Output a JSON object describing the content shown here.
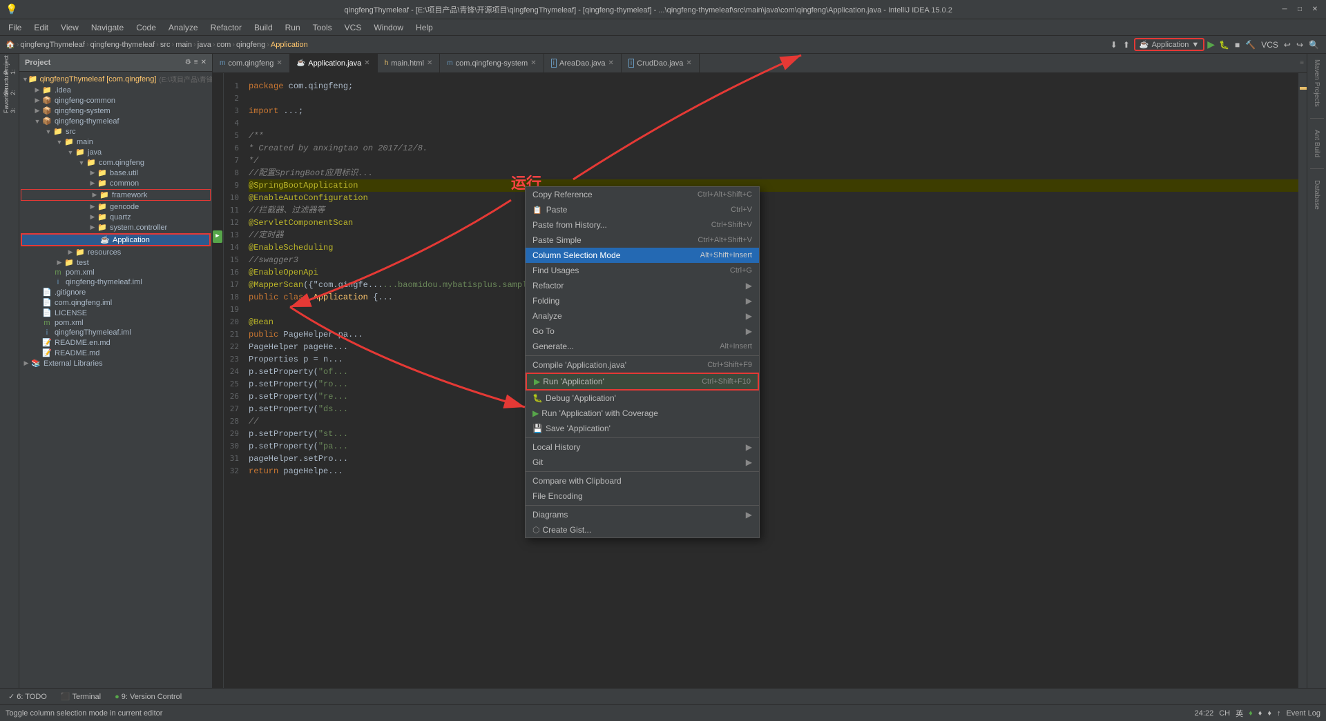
{
  "titleBar": {
    "title": "qingfengThymeleaf - [E:\\项目产品\\青锋\\开源项目\\qingfengThymeleaf] - [qingfeng-thymeleaf] - ...\\qingfeng-thymeleaf\\src\\main\\java\\com\\qingfeng\\Application.java - IntelliJ IDEA 15.0.2",
    "minimize": "─",
    "maximize": "□",
    "close": "✕"
  },
  "menuBar": {
    "items": [
      "File",
      "Edit",
      "View",
      "Navigate",
      "Code",
      "Analyze",
      "Refactor",
      "Build",
      "Run",
      "Tools",
      "VCS",
      "Window",
      "Help"
    ]
  },
  "breadcrumb": {
    "parts": [
      "qingfengThymeleaf",
      "qingfeng-thymeleaf",
      "src",
      "main",
      "java",
      "com",
      "qingfeng",
      "Application"
    ],
    "runConfig": "Application"
  },
  "projectPanel": {
    "title": "Project",
    "tree": [
      {
        "level": 0,
        "type": "project",
        "label": "qingfengThymeleaf [com.qingfeng]",
        "sub": "E:\\项目产品\\青锋\\开源项目\\q",
        "expanded": true
      },
      {
        "level": 1,
        "type": "folder",
        "label": ".idea",
        "expanded": false
      },
      {
        "level": 1,
        "type": "module",
        "label": "qingfeng-common",
        "expanded": false
      },
      {
        "level": 1,
        "type": "module",
        "label": "qingfeng-system",
        "expanded": false
      },
      {
        "level": 1,
        "type": "module",
        "label": "qingfeng-thymeleaf",
        "expanded": true
      },
      {
        "level": 2,
        "type": "folder",
        "label": "src",
        "expanded": true
      },
      {
        "level": 3,
        "type": "folder",
        "label": "main",
        "expanded": true
      },
      {
        "level": 4,
        "type": "folder",
        "label": "java",
        "expanded": true
      },
      {
        "level": 5,
        "type": "folder",
        "label": "com.qingfeng",
        "expanded": true
      },
      {
        "level": 6,
        "type": "folder",
        "label": "base.util",
        "expanded": false
      },
      {
        "level": 6,
        "type": "folder",
        "label": "common",
        "expanded": false
      },
      {
        "level": 6,
        "type": "folder",
        "label": "framework",
        "expanded": false,
        "highlight": true
      },
      {
        "level": 6,
        "type": "folder",
        "label": "gencode",
        "expanded": false
      },
      {
        "level": 6,
        "type": "folder",
        "label": "quartz",
        "expanded": false
      },
      {
        "level": 6,
        "type": "folder",
        "label": "system.controller",
        "expanded": false
      },
      {
        "level": 6,
        "type": "java",
        "label": "Application",
        "selected": true,
        "highlighted": true
      },
      {
        "level": 4,
        "type": "folder",
        "label": "resources",
        "expanded": false
      },
      {
        "level": 3,
        "type": "folder",
        "label": "test",
        "expanded": false
      },
      {
        "level": 2,
        "type": "xml",
        "label": "pom.xml"
      },
      {
        "level": 2,
        "type": "iml",
        "label": "qingfeng-thymeleaf.iml"
      },
      {
        "level": 1,
        "type": "file",
        "label": ".gitignore"
      },
      {
        "level": 1,
        "type": "file",
        "label": "com.qingfeng.iml"
      },
      {
        "level": 1,
        "type": "file",
        "label": "LICENSE"
      },
      {
        "level": 1,
        "type": "xml",
        "label": "pom.xml"
      },
      {
        "level": 1,
        "type": "iml",
        "label": "qingfengThymeleaf.iml"
      },
      {
        "level": 1,
        "type": "md",
        "label": "README.en.md"
      },
      {
        "level": 1,
        "type": "md",
        "label": "README.md"
      },
      {
        "level": 0,
        "type": "folder",
        "label": "External Libraries",
        "expanded": false
      }
    ]
  },
  "tabs": [
    {
      "label": "com.qingfeng",
      "active": false,
      "icon": "m"
    },
    {
      "label": "Application.java",
      "active": true,
      "icon": "j"
    },
    {
      "label": "main.html",
      "active": false,
      "icon": "h"
    },
    {
      "label": "com.qingfeng-system",
      "active": false,
      "icon": "m"
    },
    {
      "label": "AreaDao.java",
      "active": false,
      "icon": "i"
    },
    {
      "label": "CrudDao.java",
      "active": false,
      "icon": "i"
    }
  ],
  "code": {
    "lines": [
      {
        "n": 1,
        "text": "package com.qingfeng;",
        "parts": [
          {
            "t": "kw",
            "v": "package"
          },
          {
            "t": "plain",
            "v": " com.qingfeng;"
          }
        ]
      },
      {
        "n": 2,
        "text": ""
      },
      {
        "n": 3,
        "text": "import ...;",
        "parts": [
          {
            "t": "kw",
            "v": "import"
          },
          {
            "t": "plain",
            "v": " ...;"
          }
        ]
      },
      {
        "n": 4,
        "text": ""
      },
      {
        "n": 5,
        "text": "/**",
        "parts": [
          {
            "t": "comment",
            "v": "/**"
          }
        ]
      },
      {
        "n": 6,
        "text": " * Created by anxingtao on 2017/12/8.",
        "parts": [
          {
            "t": "comment",
            "v": " * Created by anxingtao on 2017/12/8."
          }
        ]
      },
      {
        "n": 7,
        "text": " */",
        "parts": [
          {
            "t": "comment",
            "v": " */"
          }
        ]
      },
      {
        "n": 8,
        "text": "//配置SpringBoot应用标识...",
        "parts": [
          {
            "t": "comment",
            "v": "//配置SpringBoot应用标识..."
          }
        ]
      },
      {
        "n": 9,
        "text": "@SpringBootApplication",
        "parts": [
          {
            "t": "anno",
            "v": "@SpringBootApplication"
          }
        ]
      },
      {
        "n": 10,
        "text": "@EnableAutoConfiguration",
        "parts": [
          {
            "t": "anno",
            "v": "@EnableAutoConfiguration"
          }
        ]
      },
      {
        "n": 11,
        "text": "//拦截器、过滤器等",
        "parts": [
          {
            "t": "comment",
            "v": "//拦截器、过滤器等"
          }
        ]
      },
      {
        "n": 12,
        "text": "@ServletComponentScan",
        "parts": [
          {
            "t": "anno",
            "v": "@ServletComponentScan"
          }
        ]
      },
      {
        "n": 13,
        "text": "//定时器",
        "parts": [
          {
            "t": "comment",
            "v": "//定时器"
          }
        ]
      },
      {
        "n": 14,
        "text": "@EnableScheduling",
        "parts": [
          {
            "t": "anno",
            "v": "@EnableScheduling"
          }
        ]
      },
      {
        "n": 15,
        "text": "//swagger3",
        "parts": [
          {
            "t": "comment",
            "v": "//swagger3"
          }
        ]
      },
      {
        "n": 16,
        "text": "@EnableOpenApi",
        "parts": [
          {
            "t": "anno",
            "v": "@EnableOpenApi"
          }
        ]
      },
      {
        "n": 17,
        "text": "@MapperScan({\"com.qingfe...",
        "parts": [
          {
            "t": "anno",
            "v": "@MapperScan"
          },
          {
            "t": "plain",
            "v": "({"
          },
          {
            "t": "str",
            "v": "\"com.qingfe..."
          }
        ]
      },
      {
        "n": 18,
        "text": "public class Application {...",
        "parts": [
          {
            "t": "kw",
            "v": "public"
          },
          {
            "t": "plain",
            "v": " "
          },
          {
            "t": "kw",
            "v": "class"
          },
          {
            "t": "plain",
            "v": " "
          },
          {
            "t": "cls",
            "v": "Application"
          },
          {
            "t": "plain",
            "v": " {..."
          }
        ]
      },
      {
        "n": 19,
        "text": ""
      },
      {
        "n": 20,
        "text": "    @Bean",
        "parts": [
          {
            "t": "anno",
            "v": "    @Bean"
          }
        ]
      },
      {
        "n": 21,
        "text": "    public PageHelper pa...",
        "parts": [
          {
            "t": "plain",
            "v": "    "
          },
          {
            "t": "kw",
            "v": "public"
          },
          {
            "t": "plain",
            "v": " PageHelper pa..."
          }
        ]
      },
      {
        "n": 22,
        "text": "        PageHelper pageHe...",
        "parts": [
          {
            "t": "plain",
            "v": "        PageHelper pageHe..."
          }
        ]
      },
      {
        "n": 23,
        "text": "        Properties p = n...",
        "parts": [
          {
            "t": "plain",
            "v": "        Properties p = n..."
          }
        ]
      },
      {
        "n": 24,
        "text": "        p.setProperty(\"of...",
        "parts": [
          {
            "t": "plain",
            "v": "        p.setProperty("
          },
          {
            "t": "str",
            "v": "\"of..."
          }
        ]
      },
      {
        "n": 25,
        "text": "        p.setProperty(\"ro...",
        "parts": [
          {
            "t": "plain",
            "v": "        p.setProperty("
          },
          {
            "t": "str",
            "v": "\"ro..."
          }
        ]
      },
      {
        "n": 26,
        "text": "        p.setProperty(\"re...",
        "parts": [
          {
            "t": "plain",
            "v": "        p.setProperty("
          },
          {
            "t": "str",
            "v": "\"re..."
          }
        ]
      },
      {
        "n": 27,
        "text": "        p.setProperty(\"ds...",
        "parts": [
          {
            "t": "plain",
            "v": "        p.setProperty("
          },
          {
            "t": "str",
            "v": "\"ds..."
          }
        ]
      },
      {
        "n": 28,
        "text": "        //",
        "parts": [
          {
            "t": "comment",
            "v": "        //"
          }
        ]
      },
      {
        "n": 29,
        "text": "            p.setProperty(\"st...",
        "parts": [
          {
            "t": "plain",
            "v": "            p.setProperty("
          },
          {
            "t": "str",
            "v": "\"st..."
          }
        ]
      },
      {
        "n": 30,
        "text": "            p.setProperty(\"pa...",
        "parts": [
          {
            "t": "plain",
            "v": "            p.setProperty("
          },
          {
            "t": "str",
            "v": "\"pa..."
          }
        ]
      },
      {
        "n": 31,
        "text": "            pageHelper.setPro...",
        "parts": [
          {
            "t": "plain",
            "v": "            pageHelper.setPro..."
          }
        ]
      },
      {
        "n": 32,
        "text": "            return pageHelpe...",
        "parts": [
          {
            "t": "kw",
            "v": "            return"
          },
          {
            "t": "plain",
            "v": " pageHelpe..."
          }
        ]
      }
    ]
  },
  "contextMenu": {
    "items": [
      {
        "label": "Copy Reference",
        "shortcut": "Ctrl+Alt+Shift+C",
        "type": "item"
      },
      {
        "label": "Paste",
        "shortcut": "Ctrl+V",
        "type": "item"
      },
      {
        "label": "Paste from History...",
        "shortcut": "Ctrl+Shift+V",
        "type": "item"
      },
      {
        "label": "Paste Simple",
        "shortcut": "Ctrl+Alt+Shift+V",
        "type": "item"
      },
      {
        "label": "Column Selection Mode",
        "shortcut": "Alt+Shift+Insert",
        "type": "item",
        "highlighted": true
      },
      {
        "label": "Find Usages",
        "shortcut": "Ctrl+G",
        "type": "item"
      },
      {
        "label": "Refactor",
        "shortcut": "",
        "type": "submenu"
      },
      {
        "label": "Folding",
        "shortcut": "",
        "type": "submenu"
      },
      {
        "label": "Analyze",
        "shortcut": "",
        "type": "submenu"
      },
      {
        "label": "Go To",
        "shortcut": "",
        "type": "submenu"
      },
      {
        "label": "Generate...",
        "shortcut": "Alt+Insert",
        "type": "item"
      },
      {
        "type": "divider"
      },
      {
        "label": "Compile 'Application.java'",
        "shortcut": "Ctrl+Shift+F9",
        "type": "item"
      },
      {
        "label": "Run 'Application'",
        "shortcut": "Ctrl+Shift+F10",
        "type": "item",
        "boxed": true
      },
      {
        "label": "Debug 'Application'",
        "shortcut": "",
        "type": "item"
      },
      {
        "label": "Run 'Application' with Coverage",
        "shortcut": "",
        "type": "item"
      },
      {
        "label": "Save 'Application'",
        "shortcut": "",
        "type": "item"
      },
      {
        "type": "divider"
      },
      {
        "label": "Local History",
        "shortcut": "",
        "type": "submenu"
      },
      {
        "label": "Git",
        "shortcut": "",
        "type": "submenu"
      },
      {
        "type": "divider"
      },
      {
        "label": "Compare with Clipboard",
        "shortcut": "",
        "type": "item"
      },
      {
        "label": "File Encoding",
        "shortcut": "",
        "type": "item"
      },
      {
        "type": "divider"
      },
      {
        "label": "Diagrams",
        "shortcut": "",
        "type": "submenu"
      },
      {
        "label": "Create Gist...",
        "shortcut": "",
        "type": "item"
      }
    ]
  },
  "bottomTabs": [
    {
      "label": "6: TODO",
      "icon": ""
    },
    {
      "label": "Terminal",
      "icon": ""
    },
    {
      "label": "9: Version Control",
      "icon": "●"
    }
  ],
  "statusBar": {
    "left": "Toggle column selection mode in current editor",
    "right": "24:22    CH  英  ♦  ♦  ♦  ♦  ↑  Event Log"
  },
  "rightSidebar": {
    "items": [
      "Maven Projects",
      "Ant Build",
      "Database"
    ]
  },
  "runLabel": "运行"
}
